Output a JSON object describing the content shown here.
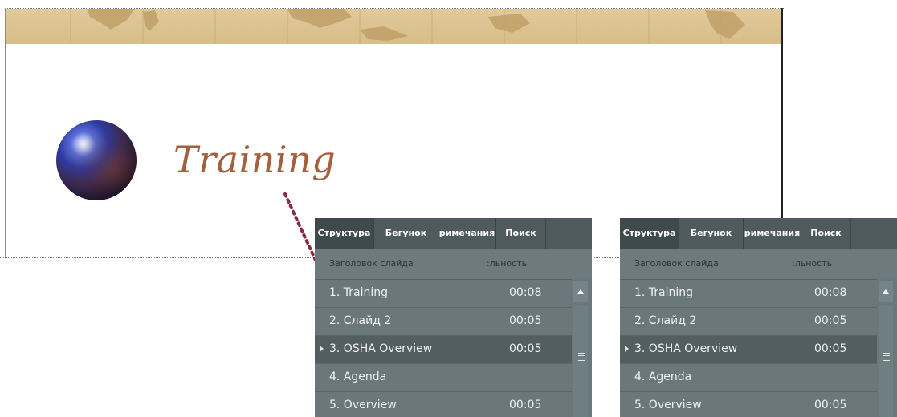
{
  "slide": {
    "title": "Training"
  },
  "panels": [
    {
      "tabs": [
        "Структура",
        "Бегунок",
        "римечания",
        "Поиск"
      ],
      "active_tab": 0,
      "columns": {
        "title": "Заголовок слайда",
        "duration": ":льность"
      },
      "rows": [
        {
          "label": "1. Training",
          "duration": "00:08",
          "selected": false,
          "current": false
        },
        {
          "label": "2. Слайд 2",
          "duration": "00:05",
          "selected": false,
          "current": false
        },
        {
          "label": "3. OSHA Overview",
          "duration": "00:05",
          "selected": true,
          "current": true
        },
        {
          "label": "4. Agenda",
          "duration": "",
          "selected": false,
          "current": false
        },
        {
          "label": "5. Overview",
          "duration": "00:05",
          "selected": false,
          "current": false
        }
      ]
    },
    {
      "tabs": [
        "Структура",
        "Бегунок",
        "римечания",
        "Поиск"
      ],
      "active_tab": 0,
      "columns": {
        "title": "Заголовок слайда",
        "duration": ":льность"
      },
      "rows": [
        {
          "label": "1. Training",
          "duration": "00:08",
          "selected": false,
          "current": false
        },
        {
          "label": "2. Слайд 2",
          "duration": "00:05",
          "selected": false,
          "current": false
        },
        {
          "label": "3. OSHA Overview",
          "duration": "00:05",
          "selected": true,
          "current": true
        },
        {
          "label": "4. Agenda",
          "duration": "",
          "selected": false,
          "current": false
        },
        {
          "label": "5. Overview",
          "duration": "00:05",
          "selected": false,
          "current": false
        }
      ]
    }
  ],
  "colors": {
    "title": "#a45f3b",
    "panel_bg": "#5e6d70",
    "banner": "#d7bd89"
  },
  "icons": [
    "globe-icon",
    "scroll-up-icon",
    "current-slide-arrow-icon",
    "scroll-grip-icon"
  ]
}
